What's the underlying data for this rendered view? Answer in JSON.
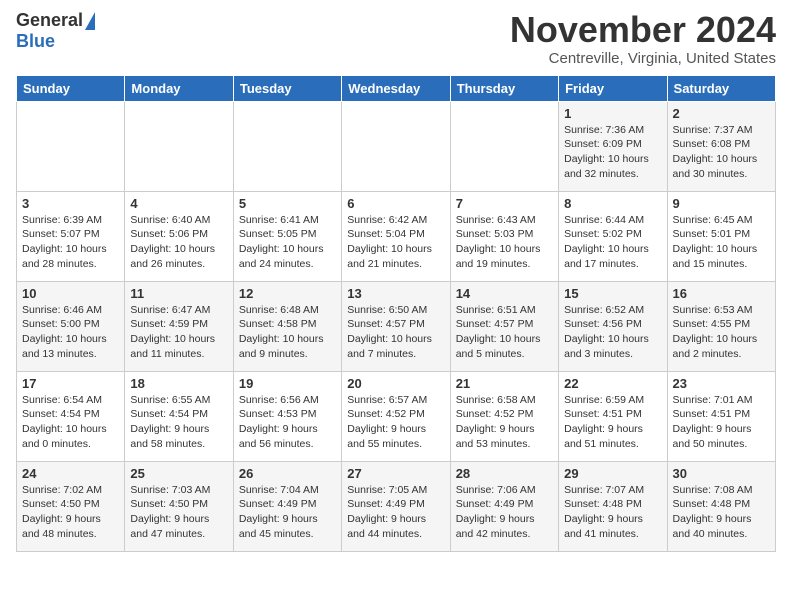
{
  "header": {
    "logo_general": "General",
    "logo_blue": "Blue",
    "month_title": "November 2024",
    "location": "Centreville, Virginia, United States"
  },
  "weekdays": [
    "Sunday",
    "Monday",
    "Tuesday",
    "Wednesday",
    "Thursday",
    "Friday",
    "Saturday"
  ],
  "weeks": [
    [
      {
        "day": "",
        "info": ""
      },
      {
        "day": "",
        "info": ""
      },
      {
        "day": "",
        "info": ""
      },
      {
        "day": "",
        "info": ""
      },
      {
        "day": "",
        "info": ""
      },
      {
        "day": "1",
        "info": "Sunrise: 7:36 AM\nSunset: 6:09 PM\nDaylight: 10 hours\nand 32 minutes."
      },
      {
        "day": "2",
        "info": "Sunrise: 7:37 AM\nSunset: 6:08 PM\nDaylight: 10 hours\nand 30 minutes."
      }
    ],
    [
      {
        "day": "3",
        "info": "Sunrise: 6:39 AM\nSunset: 5:07 PM\nDaylight: 10 hours\nand 28 minutes."
      },
      {
        "day": "4",
        "info": "Sunrise: 6:40 AM\nSunset: 5:06 PM\nDaylight: 10 hours\nand 26 minutes."
      },
      {
        "day": "5",
        "info": "Sunrise: 6:41 AM\nSunset: 5:05 PM\nDaylight: 10 hours\nand 24 minutes."
      },
      {
        "day": "6",
        "info": "Sunrise: 6:42 AM\nSunset: 5:04 PM\nDaylight: 10 hours\nand 21 minutes."
      },
      {
        "day": "7",
        "info": "Sunrise: 6:43 AM\nSunset: 5:03 PM\nDaylight: 10 hours\nand 19 minutes."
      },
      {
        "day": "8",
        "info": "Sunrise: 6:44 AM\nSunset: 5:02 PM\nDaylight: 10 hours\nand 17 minutes."
      },
      {
        "day": "9",
        "info": "Sunrise: 6:45 AM\nSunset: 5:01 PM\nDaylight: 10 hours\nand 15 minutes."
      }
    ],
    [
      {
        "day": "10",
        "info": "Sunrise: 6:46 AM\nSunset: 5:00 PM\nDaylight: 10 hours\nand 13 minutes."
      },
      {
        "day": "11",
        "info": "Sunrise: 6:47 AM\nSunset: 4:59 PM\nDaylight: 10 hours\nand 11 minutes."
      },
      {
        "day": "12",
        "info": "Sunrise: 6:48 AM\nSunset: 4:58 PM\nDaylight: 10 hours\nand 9 minutes."
      },
      {
        "day": "13",
        "info": "Sunrise: 6:50 AM\nSunset: 4:57 PM\nDaylight: 10 hours\nand 7 minutes."
      },
      {
        "day": "14",
        "info": "Sunrise: 6:51 AM\nSunset: 4:57 PM\nDaylight: 10 hours\nand 5 minutes."
      },
      {
        "day": "15",
        "info": "Sunrise: 6:52 AM\nSunset: 4:56 PM\nDaylight: 10 hours\nand 3 minutes."
      },
      {
        "day": "16",
        "info": "Sunrise: 6:53 AM\nSunset: 4:55 PM\nDaylight: 10 hours\nand 2 minutes."
      }
    ],
    [
      {
        "day": "17",
        "info": "Sunrise: 6:54 AM\nSunset: 4:54 PM\nDaylight: 10 hours\nand 0 minutes."
      },
      {
        "day": "18",
        "info": "Sunrise: 6:55 AM\nSunset: 4:54 PM\nDaylight: 9 hours\nand 58 minutes."
      },
      {
        "day": "19",
        "info": "Sunrise: 6:56 AM\nSunset: 4:53 PM\nDaylight: 9 hours\nand 56 minutes."
      },
      {
        "day": "20",
        "info": "Sunrise: 6:57 AM\nSunset: 4:52 PM\nDaylight: 9 hours\nand 55 minutes."
      },
      {
        "day": "21",
        "info": "Sunrise: 6:58 AM\nSunset: 4:52 PM\nDaylight: 9 hours\nand 53 minutes."
      },
      {
        "day": "22",
        "info": "Sunrise: 6:59 AM\nSunset: 4:51 PM\nDaylight: 9 hours\nand 51 minutes."
      },
      {
        "day": "23",
        "info": "Sunrise: 7:01 AM\nSunset: 4:51 PM\nDaylight: 9 hours\nand 50 minutes."
      }
    ],
    [
      {
        "day": "24",
        "info": "Sunrise: 7:02 AM\nSunset: 4:50 PM\nDaylight: 9 hours\nand 48 minutes."
      },
      {
        "day": "25",
        "info": "Sunrise: 7:03 AM\nSunset: 4:50 PM\nDaylight: 9 hours\nand 47 minutes."
      },
      {
        "day": "26",
        "info": "Sunrise: 7:04 AM\nSunset: 4:49 PM\nDaylight: 9 hours\nand 45 minutes."
      },
      {
        "day": "27",
        "info": "Sunrise: 7:05 AM\nSunset: 4:49 PM\nDaylight: 9 hours\nand 44 minutes."
      },
      {
        "day": "28",
        "info": "Sunrise: 7:06 AM\nSunset: 4:49 PM\nDaylight: 9 hours\nand 42 minutes."
      },
      {
        "day": "29",
        "info": "Sunrise: 7:07 AM\nSunset: 4:48 PM\nDaylight: 9 hours\nand 41 minutes."
      },
      {
        "day": "30",
        "info": "Sunrise: 7:08 AM\nSunset: 4:48 PM\nDaylight: 9 hours\nand 40 minutes."
      }
    ]
  ]
}
